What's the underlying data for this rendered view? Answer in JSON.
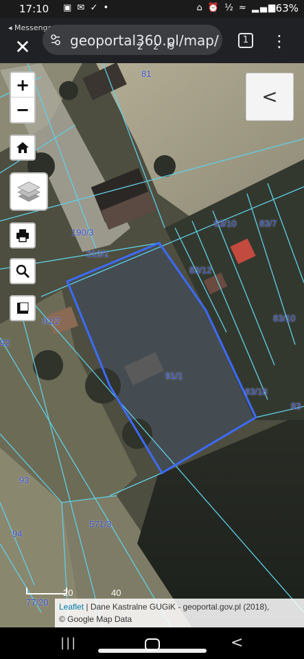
{
  "status_bar": {
    "time": "17:10",
    "left_icons": "▣ ✉ ✓ •",
    "right_icons": "⌂ ⏰ ½ ≈ ▂▄▆",
    "battery": "63%"
  },
  "browser": {
    "back_app": "◂ Messenger",
    "close_icon": "✕",
    "url": "geoportal360.pl/map/",
    "url_overlay": "2 z 9",
    "tab_count": "1",
    "menu_icon": "⋮"
  },
  "map": {
    "controls": {
      "zoom_in": "+",
      "zoom_out": "−",
      "side_panel": "<"
    },
    "parcels": [
      {
        "label": "81"
      },
      {
        "label": "190/3"
      },
      {
        "label": "213/1"
      },
      {
        "label": "83/10"
      },
      {
        "label": "83/7"
      },
      {
        "label": "83/12"
      },
      {
        "label": "83/10"
      },
      {
        "label": "91/2"
      },
      {
        "label": "92"
      },
      {
        "label": "91/1"
      },
      {
        "label": "83/18"
      },
      {
        "label": "83"
      },
      {
        "label": "93"
      },
      {
        "label": "94"
      },
      {
        "label": "571/3"
      },
      {
        "label": "77/20"
      }
    ],
    "scale": {
      "left": "20",
      "right": "40"
    },
    "attribution": {
      "link": "Leaflet",
      "text": " | Dane Kastralne GUGiK - geoportal.gov.pl (2018),",
      "line2": "© Google Map Data"
    },
    "colors": {
      "parcel_lines": "#5fd0e8",
      "selected_parcel": "#3d6bff",
      "label": "#3650c8"
    }
  },
  "nav_bar": {
    "recent": "|||",
    "back": "<"
  }
}
